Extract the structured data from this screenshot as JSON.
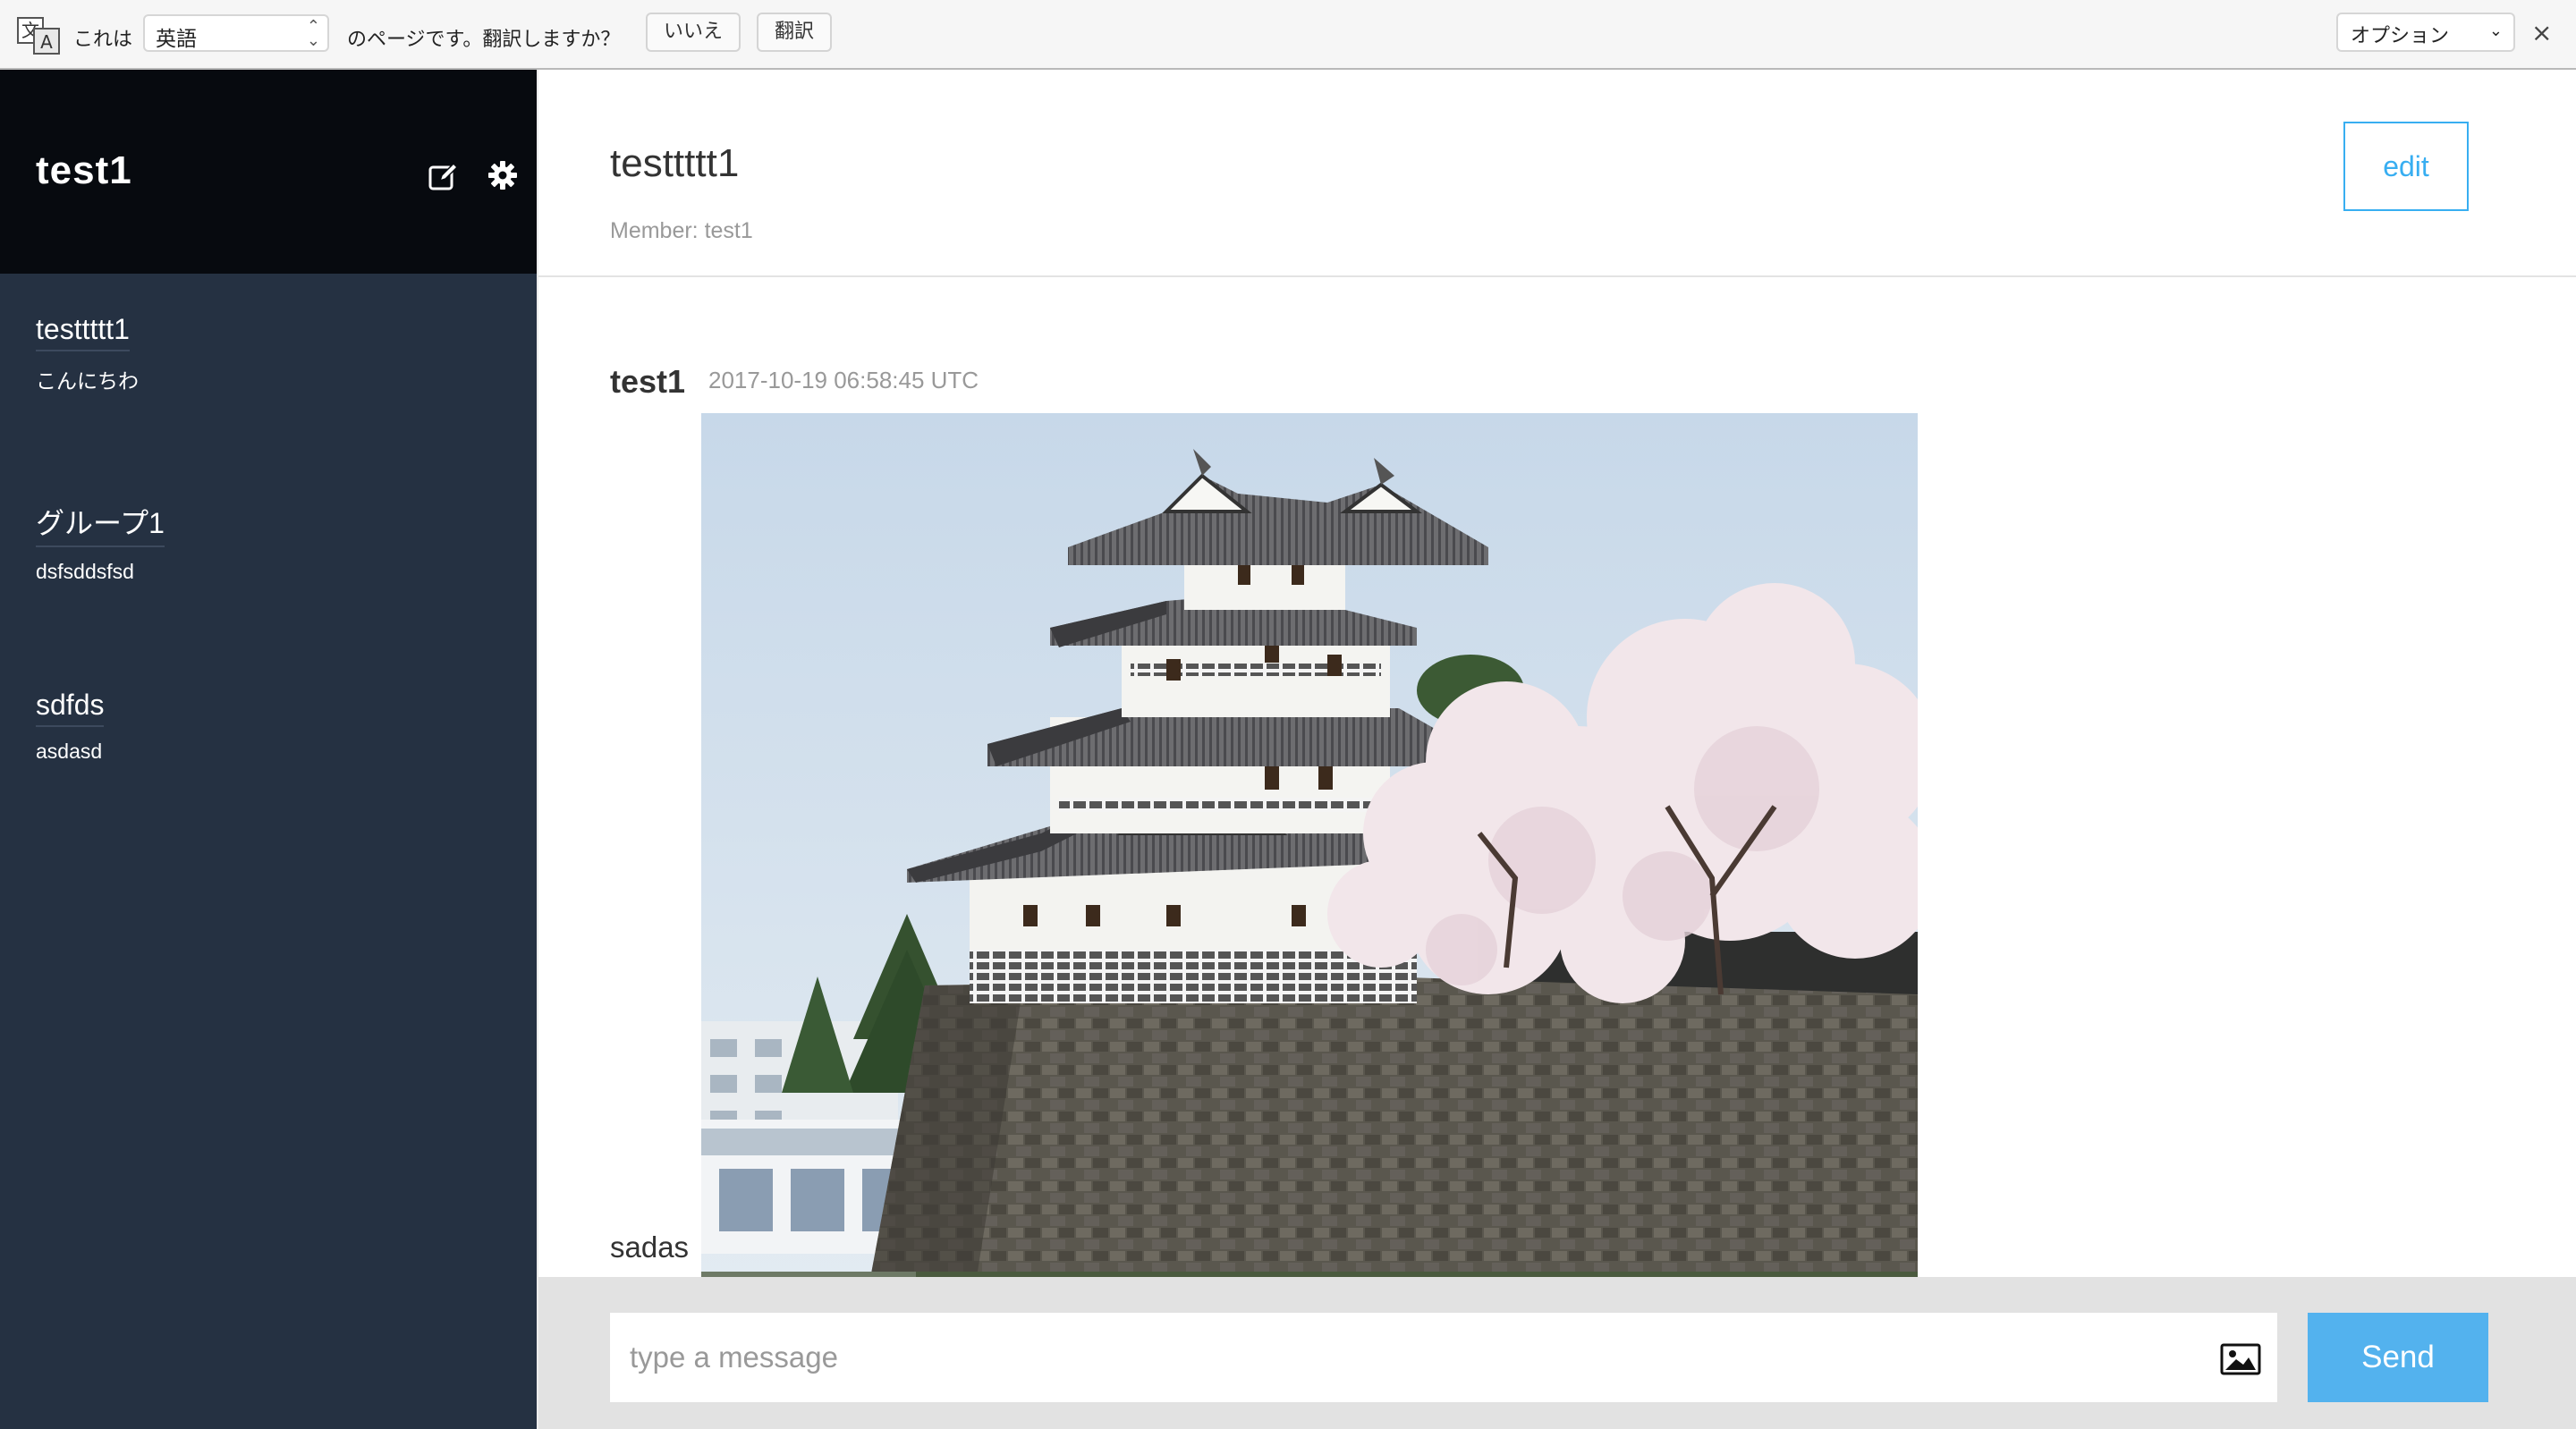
{
  "translate_bar": {
    "prefix": "これは",
    "language": "英語",
    "suffix": "のページです。翻訳しますか？",
    "no_label": "いいえ",
    "translate_label": "翻訳",
    "options_label": "オプション",
    "close_glyph": "×"
  },
  "sidebar": {
    "current_user": "test1",
    "groups": [
      {
        "name": "testtttt1",
        "last_message": "こんにちわ"
      },
      {
        "name": "グループ1",
        "last_message": "dsfsddsfsd"
      },
      {
        "name": "sdfds",
        "last_message": "asdasd"
      }
    ]
  },
  "main": {
    "group_name": "testtttt1",
    "members": "Member: test1",
    "edit_label": "edit",
    "messages": [
      {
        "user": "test1",
        "timestamp": "2017-10-19 06:58:45 UTC",
        "text": "sadas",
        "image": "castle-with-cherry-blossoms"
      }
    ],
    "composer": {
      "placeholder": "type a message",
      "send_label": "Send"
    }
  },
  "colors": {
    "sidebar_bg": "#253142",
    "sidebar_header_bg": "#070a0f",
    "accent": "#38aef1",
    "send_button": "#53b2ee",
    "composer_bg": "#e2e2e2"
  }
}
